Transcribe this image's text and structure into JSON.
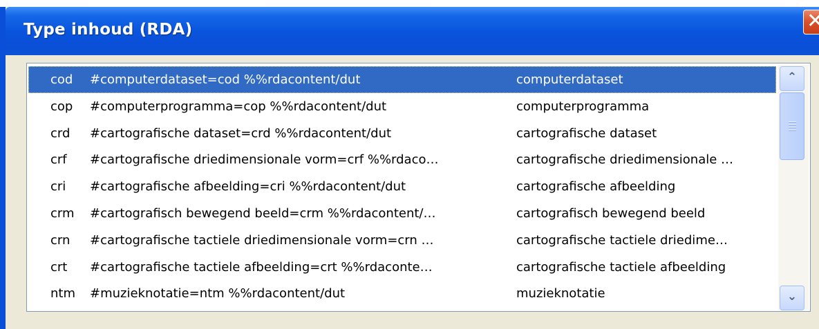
{
  "window": {
    "title": "Type inhoud (RDA)",
    "close_label": "✕"
  },
  "list": {
    "rows": [
      {
        "code": "cod",
        "description": "#computerdataset=cod %%rdacontent/dut",
        "label": "computerdataset"
      },
      {
        "code": "cop",
        "description": "#computerprogramma=cop %%rdacontent/dut",
        "label": "computerprogramma"
      },
      {
        "code": "crd",
        "description": "#cartografische dataset=crd %%rdacontent/dut",
        "label": "cartografische dataset"
      },
      {
        "code": "crf",
        "description": "#cartografische driedimensionale vorm=crf %%rdaco…",
        "label": "cartografische driedimensionale …"
      },
      {
        "code": "cri",
        "description": "#cartografische afbeelding=cri %%rdacontent/dut",
        "label": "cartografische afbeelding"
      },
      {
        "code": "crm",
        "description": "#cartografisch bewegend beeld=crm %%rdacontent/…",
        "label": "cartografisch bewegend beeld"
      },
      {
        "code": "crn",
        "description": "#cartografische tactiele driedimensionale vorm=crn …",
        "label": "cartografische tactiele driedime…"
      },
      {
        "code": "crt",
        "description": "#cartografische tactiele afbeelding=crt %%rdaconte…",
        "label": "cartografische tactiele afbeelding"
      },
      {
        "code": "ntm",
        "description": "#muzieknotatie=ntm %%rdacontent/dut",
        "label": "muzieknotatie"
      }
    ],
    "selected_index": 0
  },
  "scrollbar": {
    "up_icon": "arrow-up-icon",
    "down_icon": "arrow-down-icon",
    "up_glyph": "⌃",
    "down_glyph": "⌄"
  },
  "colors": {
    "titlebar": "#0a4fd8",
    "selection": "#316ac5",
    "close": "#d9532c"
  }
}
